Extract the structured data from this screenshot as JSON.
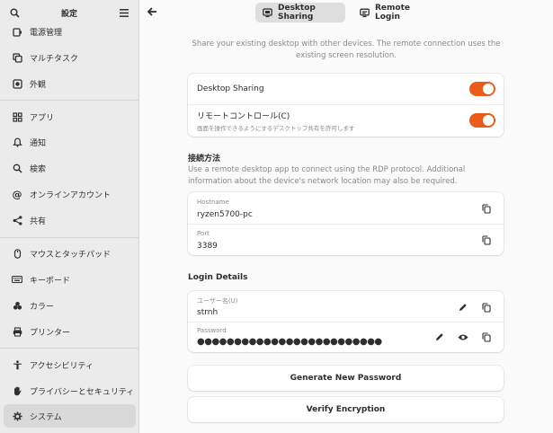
{
  "sidebar": {
    "title": "設定",
    "items": [
      {
        "label": "電源管理",
        "icon": "power-icon"
      },
      {
        "label": "マルチタスク",
        "icon": "multitask-icon"
      },
      {
        "label": "外観",
        "icon": "appearance-icon"
      },
      {
        "label": "アプリ",
        "icon": "apps-icon"
      },
      {
        "label": "通知",
        "icon": "bell-icon"
      },
      {
        "label": "検索",
        "icon": "search-icon"
      },
      {
        "label": "オンラインアカウント",
        "icon": "at-icon"
      },
      {
        "label": "共有",
        "icon": "share-icon"
      },
      {
        "label": "マウスとタッチパッド",
        "icon": "mouse-icon"
      },
      {
        "label": "キーボード",
        "icon": "keyboard-icon"
      },
      {
        "label": "カラー",
        "icon": "color-icon"
      },
      {
        "label": "プリンター",
        "icon": "printer-icon"
      },
      {
        "label": "アクセシビリティ",
        "icon": "accessibility-icon"
      },
      {
        "label": "プライバシーとセキュリティ",
        "icon": "hand-icon"
      },
      {
        "label": "システム",
        "icon": "system-icon",
        "selected": true
      }
    ]
  },
  "tabs": [
    {
      "label": "Desktop Sharing",
      "active": true
    },
    {
      "label": "Remote Login",
      "active": false
    }
  ],
  "intro": "Share your existing desktop with other devices. The remote connection uses the existing screen resolution.",
  "sharing": {
    "desktop_sharing_label": "Desktop Sharing",
    "remote_control_label": "リモートコントロール(C)",
    "remote_control_sub": "画面を操作できるようにするデスクトップ共有を許可します"
  },
  "connection": {
    "title": "接続方法",
    "description": "Use a remote desktop app to connect using the RDP protocol. Additional information about the device's network location may also be required.",
    "hostname_caption": "Hostname",
    "hostname_value": "ryzen5700-pc",
    "port_caption": "Port",
    "port_value": "3389"
  },
  "login": {
    "title": "Login Details",
    "username_caption": "ユーザー名(U)",
    "username_value": "strnh",
    "password_caption": "Password",
    "password_value": "●●●●●●●●●●●●●●●●●●●●●●●●●"
  },
  "buttons": {
    "generate": "Generate New Password",
    "verify": "Verify Encryption"
  },
  "colors": {
    "accent": "#e95c1b"
  }
}
